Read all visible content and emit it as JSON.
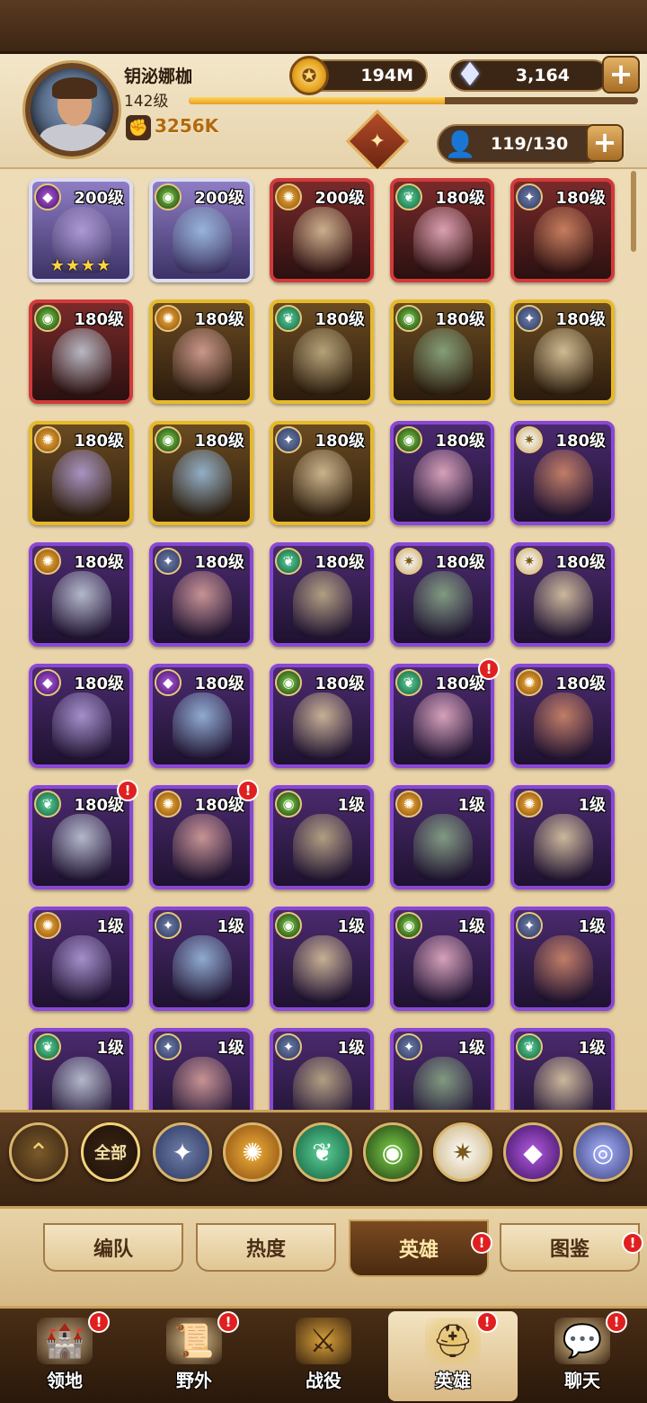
{
  "player": {
    "name": "钥泌娜枷",
    "level": "142级",
    "power": "3256K",
    "exp_fraction": 0.57
  },
  "resources": {
    "gold": "194M",
    "diamonds": "3,164",
    "hero_slots": "119/130"
  },
  "heroes": [
    {
      "level": "200级",
      "faction": "hypogean",
      "rarity": "elite",
      "stars": "★★★★",
      "alert": false
    },
    {
      "level": "200级",
      "faction": "graveborn",
      "rarity": "elite",
      "stars": "",
      "alert": false
    },
    {
      "level": "200级",
      "faction": "mauler",
      "rarity": "red",
      "stars": "",
      "alert": false
    },
    {
      "level": "180级",
      "faction": "wilder",
      "rarity": "red",
      "stars": "",
      "alert": false
    },
    {
      "level": "180级",
      "faction": "lightbearer",
      "rarity": "red",
      "stars": "",
      "alert": false
    },
    {
      "level": "180级",
      "faction": "graveborn",
      "rarity": "red",
      "stars": "",
      "alert": false
    },
    {
      "level": "180级",
      "faction": "mauler",
      "rarity": "gold",
      "stars": "",
      "alert": false
    },
    {
      "level": "180级",
      "faction": "wilder",
      "rarity": "gold",
      "stars": "",
      "alert": false
    },
    {
      "level": "180级",
      "faction": "graveborn",
      "rarity": "gold",
      "stars": "",
      "alert": false
    },
    {
      "level": "180级",
      "faction": "lightbearer",
      "rarity": "gold",
      "stars": "",
      "alert": false
    },
    {
      "level": "180级",
      "faction": "mauler",
      "rarity": "gold",
      "stars": "",
      "alert": false
    },
    {
      "level": "180级",
      "faction": "graveborn",
      "rarity": "gold",
      "stars": "",
      "alert": false
    },
    {
      "level": "180级",
      "faction": "lightbearer",
      "rarity": "gold",
      "stars": "",
      "alert": false
    },
    {
      "level": "180级",
      "faction": "graveborn",
      "rarity": "purple",
      "stars": "",
      "alert": false
    },
    {
      "level": "180级",
      "faction": "celestial",
      "rarity": "purple",
      "stars": "",
      "alert": false
    },
    {
      "level": "180级",
      "faction": "mauler",
      "rarity": "purple",
      "stars": "",
      "alert": false
    },
    {
      "level": "180级",
      "faction": "lightbearer",
      "rarity": "purple",
      "stars": "",
      "alert": false
    },
    {
      "level": "180级",
      "faction": "wilder",
      "rarity": "purple",
      "stars": "",
      "alert": false
    },
    {
      "level": "180级",
      "faction": "celestial",
      "rarity": "purple",
      "stars": "",
      "alert": false
    },
    {
      "level": "180级",
      "faction": "celestial",
      "rarity": "purple",
      "stars": "",
      "alert": false
    },
    {
      "level": "180级",
      "faction": "hypogean",
      "rarity": "purple",
      "stars": "",
      "alert": false
    },
    {
      "level": "180级",
      "faction": "hypogean",
      "rarity": "purple",
      "stars": "",
      "alert": false
    },
    {
      "level": "180级",
      "faction": "graveborn",
      "rarity": "purple",
      "stars": "",
      "alert": false
    },
    {
      "level": "180级",
      "faction": "wilder",
      "rarity": "purple",
      "stars": "",
      "alert": true
    },
    {
      "level": "180级",
      "faction": "mauler",
      "rarity": "purple",
      "stars": "",
      "alert": false
    },
    {
      "level": "180级",
      "faction": "wilder",
      "rarity": "purple",
      "stars": "",
      "alert": true
    },
    {
      "level": "180级",
      "faction": "mauler",
      "rarity": "purple",
      "stars": "",
      "alert": true
    },
    {
      "level": "1级",
      "faction": "graveborn",
      "rarity": "purple",
      "stars": "",
      "alert": false
    },
    {
      "level": "1级",
      "faction": "mauler",
      "rarity": "purple",
      "stars": "",
      "alert": false
    },
    {
      "level": "1级",
      "faction": "mauler",
      "rarity": "purple",
      "stars": "",
      "alert": false
    },
    {
      "level": "1级",
      "faction": "mauler",
      "rarity": "purple",
      "stars": "",
      "alert": false
    },
    {
      "level": "1级",
      "faction": "lightbearer",
      "rarity": "purple",
      "stars": "",
      "alert": false
    },
    {
      "level": "1级",
      "faction": "graveborn",
      "rarity": "purple",
      "stars": "",
      "alert": false
    },
    {
      "level": "1级",
      "faction": "graveborn",
      "rarity": "purple",
      "stars": "",
      "alert": false
    },
    {
      "level": "1级",
      "faction": "lightbearer",
      "rarity": "purple",
      "stars": "",
      "alert": false
    },
    {
      "level": "1级",
      "faction": "wilder",
      "rarity": "purple",
      "stars": "",
      "alert": false
    },
    {
      "level": "1级",
      "faction": "lightbearer",
      "rarity": "purple",
      "stars": "",
      "alert": false
    },
    {
      "level": "1级",
      "faction": "lightbearer",
      "rarity": "purple",
      "stars": "",
      "alert": false
    },
    {
      "level": "1级",
      "faction": "lightbearer",
      "rarity": "purple",
      "stars": "",
      "alert": false
    },
    {
      "level": "1级",
      "faction": "wilder",
      "rarity": "purple",
      "stars": "",
      "alert": false
    }
  ],
  "faction_filters": {
    "all_label": "全部",
    "items": [
      "lightbearer",
      "mauler",
      "wilder",
      "graveborn",
      "celestial",
      "hypogean",
      "dimensional"
    ]
  },
  "subtabs": [
    {
      "label": "编队",
      "active": false,
      "alert": false
    },
    {
      "label": "热度",
      "active": false,
      "alert": false
    },
    {
      "label": "英雄",
      "active": true,
      "alert": true
    },
    {
      "label": "图鉴",
      "active": false,
      "alert": true
    }
  ],
  "bottom_nav": [
    {
      "label": "领地",
      "icon": "castle-icon",
      "active": false,
      "alert": true
    },
    {
      "label": "野外",
      "icon": "map-scroll-icon",
      "active": false,
      "alert": true
    },
    {
      "label": "战役",
      "icon": "sword-icon",
      "active": false,
      "alert": false
    },
    {
      "label": "英雄",
      "icon": "helmet-icon",
      "active": true,
      "alert": true
    },
    {
      "label": "聊天",
      "icon": "chat-icon",
      "active": false,
      "alert": true
    }
  ],
  "alert_glyph": "!",
  "plus_glyph": "+"
}
